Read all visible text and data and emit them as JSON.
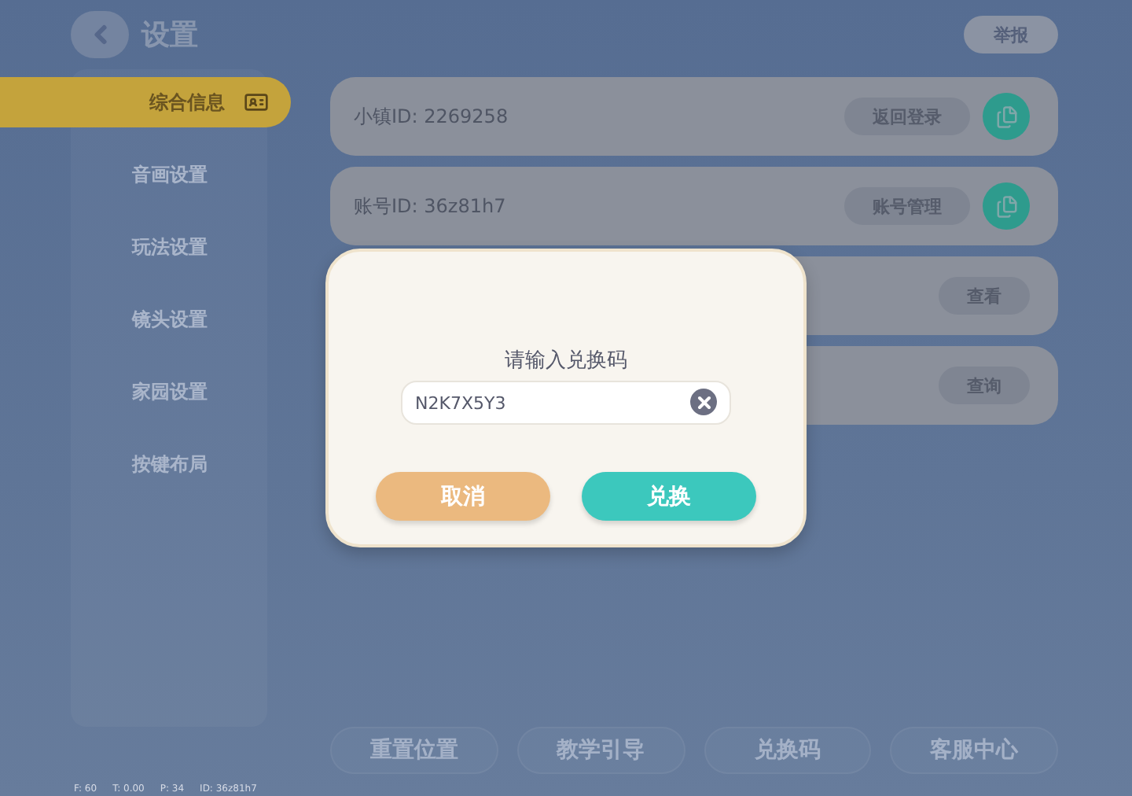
{
  "header": {
    "title": "设置",
    "report_button": "举报"
  },
  "sidebar": {
    "items": [
      {
        "label": "综合信息",
        "selected": true
      },
      {
        "label": "音画设置",
        "selected": false
      },
      {
        "label": "玩法设置",
        "selected": false
      },
      {
        "label": "镜头设置",
        "selected": false
      },
      {
        "label": "家园设置",
        "selected": false
      },
      {
        "label": "按键布局",
        "selected": false
      }
    ]
  },
  "rows": [
    {
      "label": "小镇ID:",
      "value": "2269258",
      "button": "返回登录",
      "copy": true
    },
    {
      "label": "账号ID:",
      "value": "36z81h7",
      "button": "账号管理",
      "copy": true
    },
    {
      "button": "查看",
      "copy": false
    },
    {
      "button": "查询",
      "copy": false
    }
  ],
  "bottom_buttons": [
    "重置位置",
    "教学引导",
    "兑换码",
    "客服中心"
  ],
  "debug": [
    "F: 60",
    "T: 0.00",
    "P: 34",
    "ID: 36z81h7"
  ],
  "dialog": {
    "title": "请输入兑换码",
    "input": {
      "value": "N2K7X5Y3"
    },
    "cancel": "取消",
    "confirm": "兑换"
  }
}
